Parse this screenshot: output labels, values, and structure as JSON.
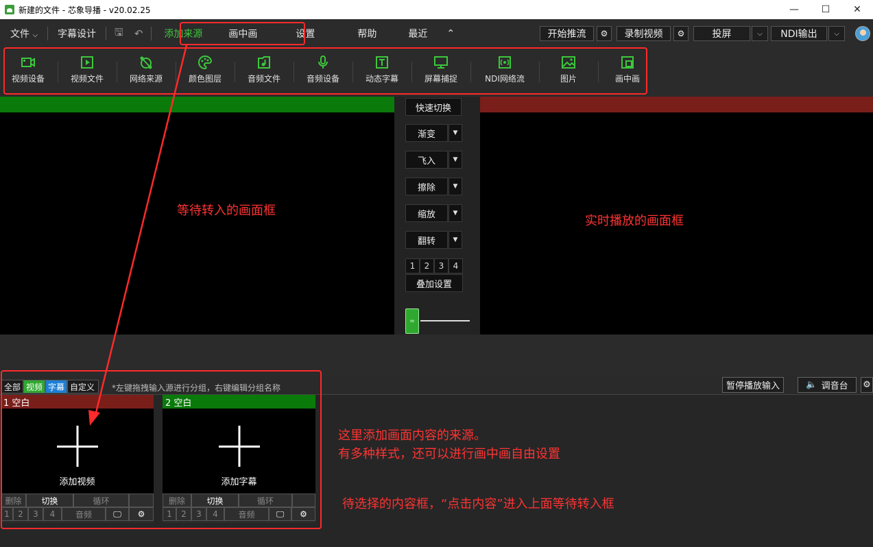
{
  "window": {
    "title": "新建的文件 - 芯象导播 - v20.02.25",
    "controls": {
      "minimize": "—",
      "maximize": "☐",
      "close": "✕"
    }
  },
  "menubar": {
    "file": "文件",
    "file_caret": "⌵",
    "subtitle_design": "字幕设计",
    "add_source": "添加来源",
    "pip": "画中画",
    "settings": "设置",
    "help": "帮助",
    "recent": "最近",
    "collapse": "⌃",
    "start_stream": "开始推流",
    "record_video": "录制视频",
    "project": "投屏",
    "ndi_output": "NDI输出",
    "gear": "⚙",
    "caret": "⌵"
  },
  "toolbar": {
    "items": [
      {
        "label": "视频设备",
        "icon": "video-camera-icon"
      },
      {
        "label": "视频文件",
        "icon": "play-file-icon"
      },
      {
        "label": "网络来源",
        "icon": "network-icon"
      },
      {
        "label": "颜色图层",
        "icon": "palette-icon"
      },
      {
        "label": "音频文件",
        "icon": "music-file-icon"
      },
      {
        "label": "音频设备",
        "icon": "microphone-icon"
      },
      {
        "label": "动态字幕",
        "icon": "text-icon"
      },
      {
        "label": "屏幕捕捉",
        "icon": "monitor-icon"
      },
      {
        "label": "NDI网络流",
        "icon": "ndi-icon"
      },
      {
        "label": "图片",
        "icon": "image-icon"
      },
      {
        "label": "画中画",
        "icon": "pip-icon"
      }
    ]
  },
  "center": {
    "quick_switch": "快速切换",
    "transitions": [
      "渐变",
      "飞入",
      "擦除",
      "缩放",
      "翻转"
    ],
    "layers": [
      "1",
      "2",
      "3",
      "4"
    ],
    "overlay_settings": "叠加设置",
    "dd": "▼",
    "slider_grip": "="
  },
  "annotations": {
    "preview": "等待转入的画面框",
    "program": "实时播放的画面框",
    "source_line1": "这里添加画面内容的来源。",
    "source_line2": "有多种样式，还可以进行画中画自由设置",
    "select_hint": "待选择的内容框，“点击内容”进入上面等待转入框"
  },
  "groups": {
    "tabs": [
      "全部",
      "视频",
      "字幕",
      "自定义"
    ],
    "hint": "*左键拖拽输入源进行分组，右键编辑分组名称",
    "pause_input": "暂停播放输入",
    "mixer": "调音台",
    "speaker_icon": "🔈",
    "gear": "⚙"
  },
  "cards": [
    {
      "title": "1 空白",
      "label": "添加视频"
    },
    {
      "title": "2 空白",
      "label": "添加字幕"
    }
  ],
  "card_buttons": {
    "delete": "删除",
    "switch": "切换",
    "loop": "循环",
    "nums": [
      "1",
      "2",
      "3",
      "4"
    ],
    "audio": "音频",
    "monitor": "🖵",
    "gear": "⚙"
  }
}
